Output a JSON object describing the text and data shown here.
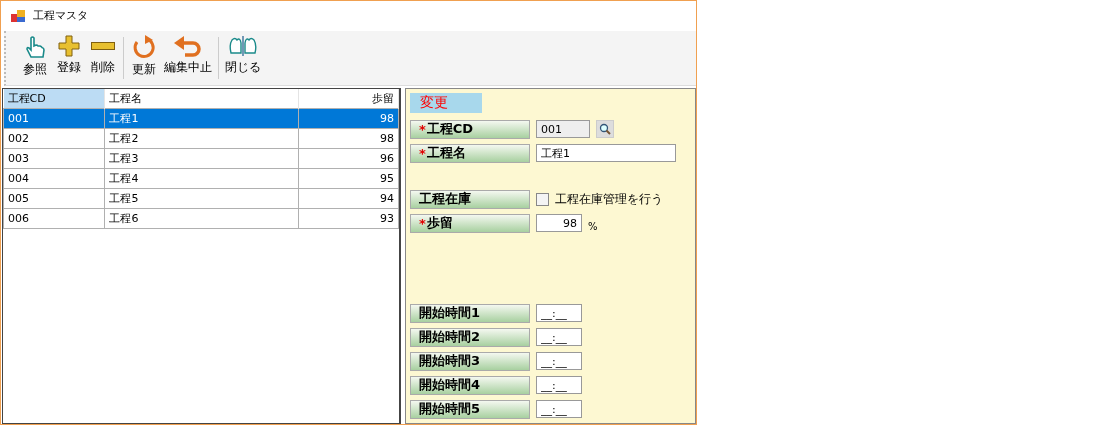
{
  "window": {
    "title": "工程マスタ"
  },
  "toolbar_groups": [
    [
      {
        "label": "参照"
      },
      {
        "label": "登録"
      },
      {
        "label": "削除"
      }
    ],
    [
      {
        "label": "更新"
      },
      {
        "label": "編集中止"
      }
    ],
    [
      {
        "label": "閉じる"
      }
    ]
  ],
  "table": {
    "columns": [
      {
        "label": "工程CD",
        "selected": true
      },
      {
        "label": "工程名",
        "selected": false
      },
      {
        "label": "歩留",
        "selected": false
      }
    ],
    "rows": [
      {
        "cells": [
          "001",
          "工程1",
          "98"
        ],
        "selected": true
      },
      {
        "cells": [
          "002",
          "工程2",
          "98"
        ],
        "selected": false
      },
      {
        "cells": [
          "003",
          "工程3",
          "96"
        ],
        "selected": false
      },
      {
        "cells": [
          "004",
          "工程4",
          "95"
        ],
        "selected": false
      },
      {
        "cells": [
          "005",
          "工程5",
          "94"
        ],
        "selected": false
      },
      {
        "cells": [
          "006",
          "工程6",
          "93"
        ],
        "selected": false
      }
    ]
  },
  "form": {
    "mode": "変更",
    "fields": [
      {
        "kind": "code",
        "mark": "*",
        "label": "工程CD",
        "value": "001"
      },
      {
        "kind": "text",
        "mark": "*",
        "label": "工程名",
        "value": "工程1"
      },
      {
        "kind": "checkbox",
        "label": "工程在庫",
        "option": "工程在庫管理を行う",
        "checked": false
      },
      {
        "kind": "number",
        "mark": "*",
        "label": "歩留",
        "value": "98",
        "unit": "%"
      },
      {
        "kind": "time",
        "label": "開始時間1",
        "value": "__:__"
      },
      {
        "kind": "time",
        "label": "開始時間2",
        "value": "__:__"
      },
      {
        "kind": "time",
        "label": "開始時間3",
        "value": "__:__"
      },
      {
        "kind": "time",
        "label": "開始時間4",
        "value": "__:__"
      },
      {
        "kind": "time",
        "label": "開始時間5",
        "value": "__:__"
      }
    ]
  }
}
